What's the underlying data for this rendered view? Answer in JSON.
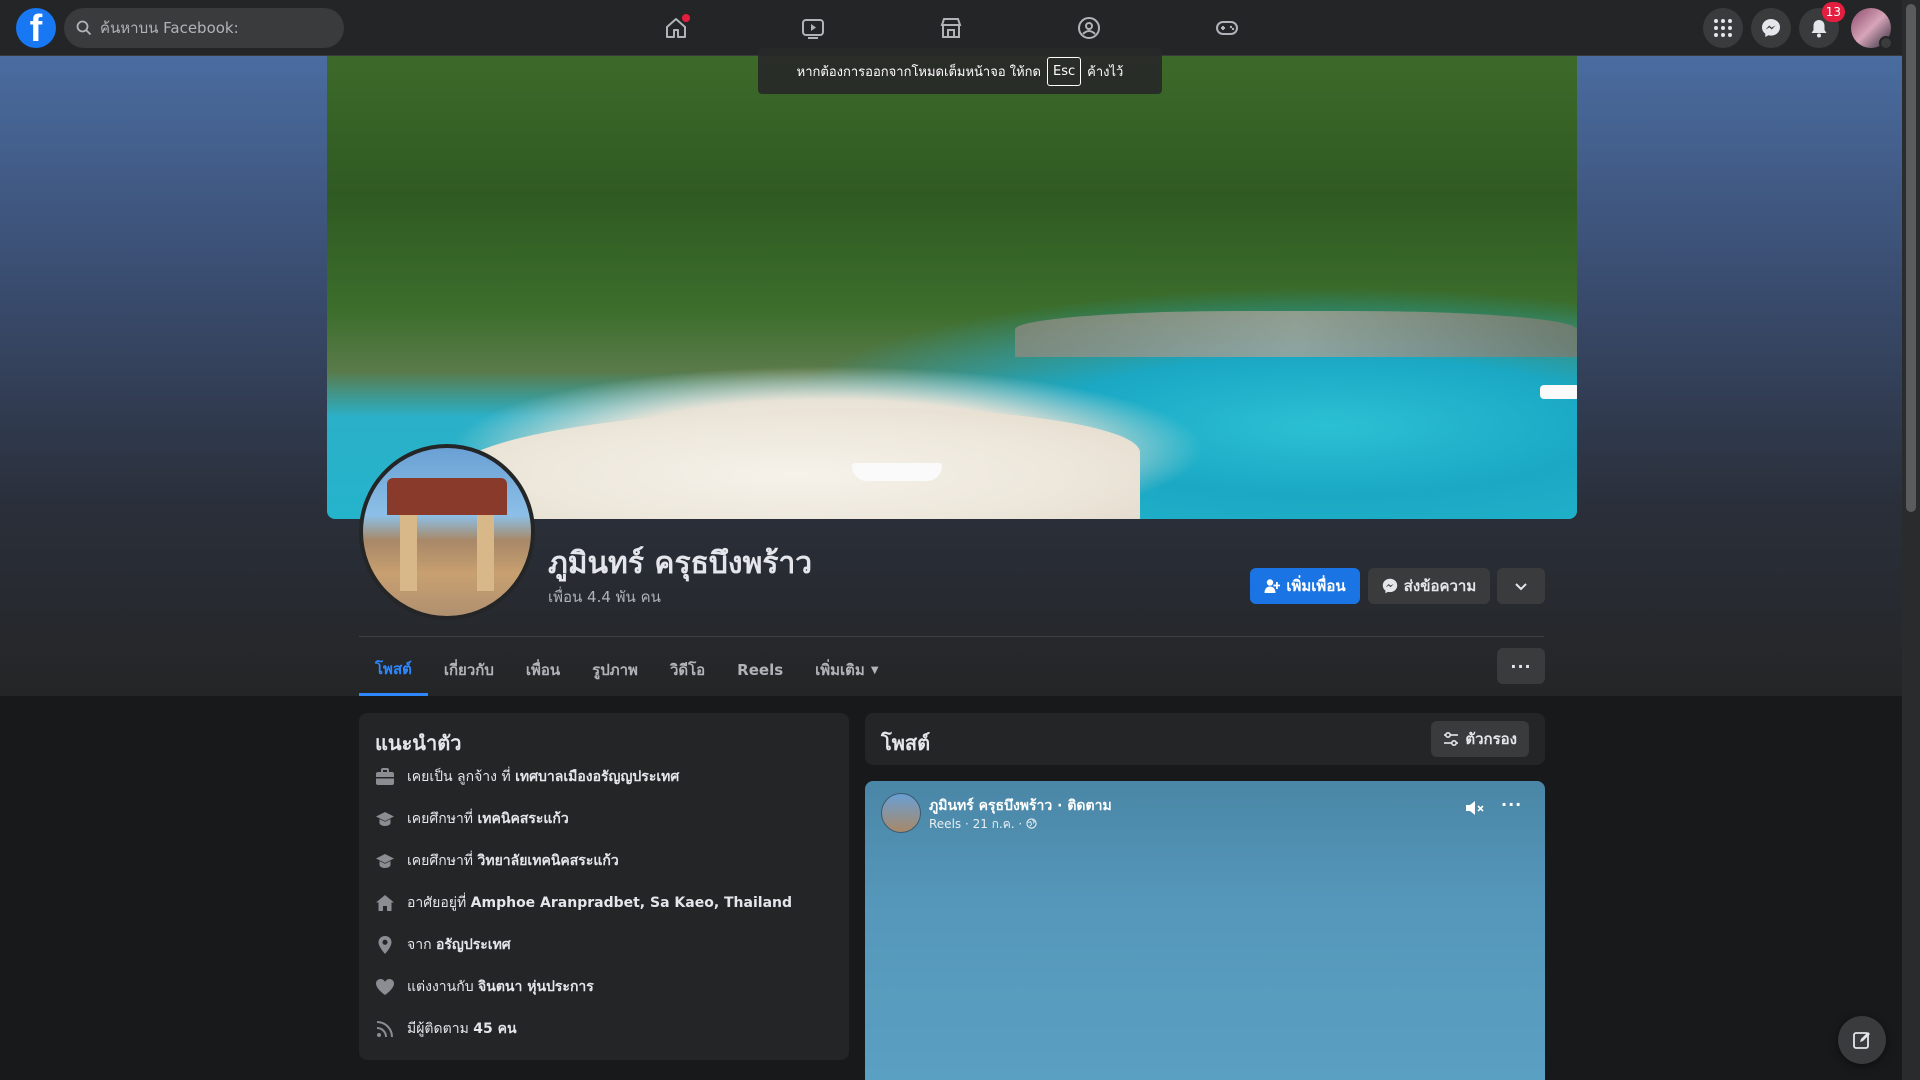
{
  "topbar": {
    "search_placeholder": "ค้นหาบน Facebook:",
    "notification_count": "13"
  },
  "toast": {
    "before": "หากต้องการออกจากโหมดเต็มหน้าจอ ให้กด",
    "key": "Esc",
    "after": "ค้างไว้"
  },
  "profile": {
    "name": "ภูมินทร์ ครุธบึงพร้าว",
    "friends": "เพื่อน 4.4 พัน คน",
    "add_friend": "เพิ่มเพื่อน",
    "message": "ส่งข้อความ"
  },
  "tabs": [
    {
      "label": "โพสต์"
    },
    {
      "label": "เกี่ยวกับ"
    },
    {
      "label": "เพื่อน"
    },
    {
      "label": "รูปภาพ"
    },
    {
      "label": "วิดีโอ"
    },
    {
      "label": "Reels"
    },
    {
      "label": "เพิ่มเติม"
    }
  ],
  "intro": {
    "title": "แนะนำตัว",
    "items": [
      {
        "prefix": "เคยเป็น ลูกจ้าง ที่ ",
        "bold": "เทศบาลเมืองอรัญญประเทศ"
      },
      {
        "prefix": "เคยศึกษาที่ ",
        "bold": "เทคนิคสระแก้ว"
      },
      {
        "prefix": "เคยศึกษาที่ ",
        "bold": "วิทยาลัยเทคนิคสระแก้ว"
      },
      {
        "prefix": "อาศัยอยู่ที่ ",
        "bold": "Amphoe Aranpradbet, Sa Kaeo, Thailand"
      },
      {
        "prefix": "จาก ",
        "bold": "อรัญประเทศ"
      },
      {
        "prefix": "แต่งงานกับ ",
        "bold": "จินตนา หุ่นประการ"
      },
      {
        "prefix": "มีผู้ติดตาม ",
        "bold": "45 คน"
      }
    ]
  },
  "posts": {
    "title": "โพสต์",
    "filter": "ตัวกรอง"
  },
  "reel": {
    "author": "ภูมินทร์ ครุธบึงพร้าว · ติดตาม",
    "meta": "Reels · 21 ก.ค. ·"
  },
  "colors": {
    "accent": "#1b74e4",
    "badge": "#e41e3f",
    "background": "#18191a",
    "surface": "#242526"
  }
}
